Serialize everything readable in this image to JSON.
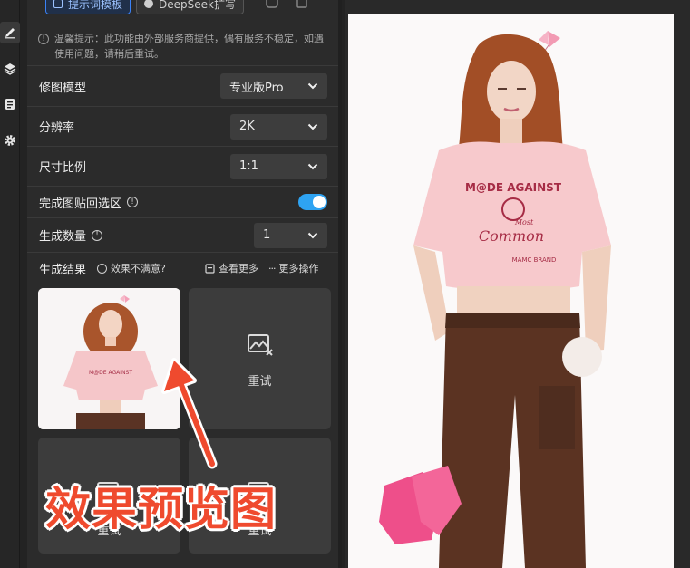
{
  "panel": {
    "top_chips": [
      "提示词模板",
      "DeepSeek扩写"
    ],
    "notice": "温馨提示：此功能由外部服务商提供，偶有服务不稳定，如遇使用问题，请稍后重试。",
    "settings": {
      "model": {
        "label": "修图模型",
        "value": "专业版Pro"
      },
      "resolution": {
        "label": "分辨率",
        "value": "2K"
      },
      "ratio": {
        "label": "尺寸比例",
        "value": "1:1"
      },
      "paste_back": {
        "label": "完成图贴回选区",
        "enabled": true
      },
      "count": {
        "label": "生成数量",
        "value": "1"
      }
    },
    "results": {
      "title": "生成结果",
      "unsatisfied": "效果不满意?",
      "view_more": "查看更多",
      "more_actions": "更多操作",
      "retry_label": "重试",
      "retry_label_2": "重试",
      "retry_label_3": "重试",
      "thumb_shirt_text": "M@DE AGAINST"
    }
  },
  "canvas": {
    "shirt_text_1": "M@DE AGAINST",
    "shirt_text_2": "Most",
    "shirt_text_3": "Common",
    "shirt_text_4": "MAMC BRAND"
  },
  "annotation": {
    "caption": "效果预览图",
    "color": "#ef4a2e"
  }
}
